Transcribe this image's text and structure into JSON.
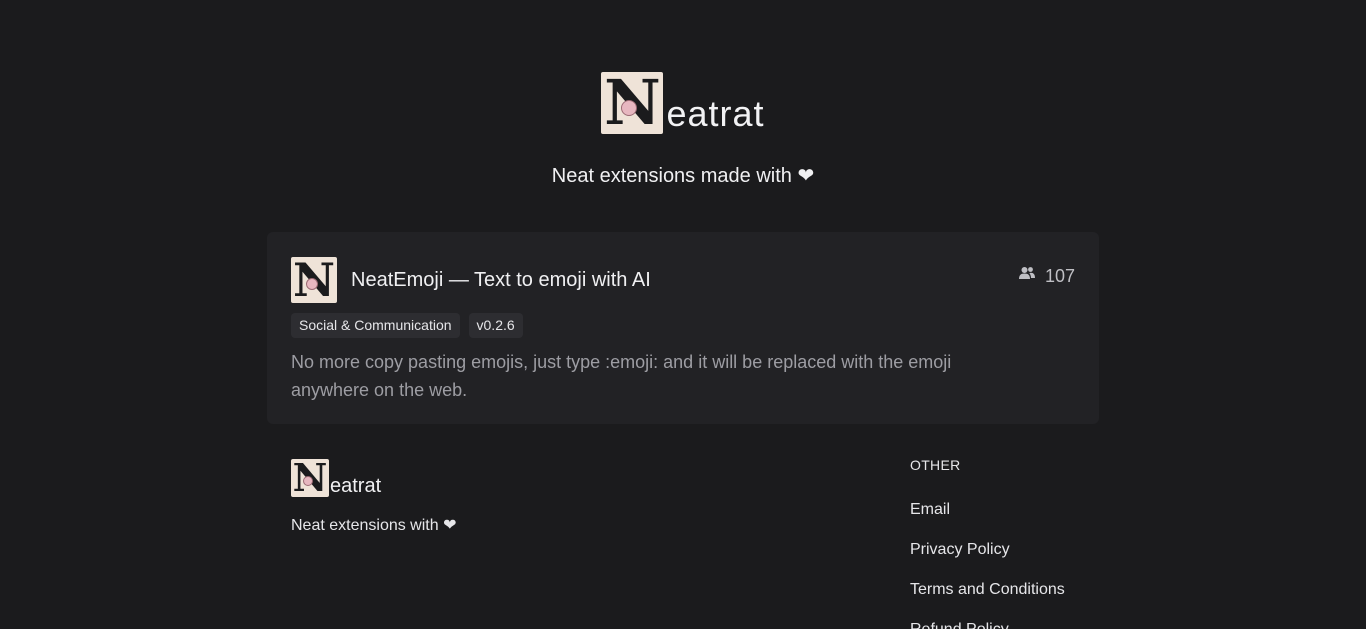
{
  "hero": {
    "brand_suffix": "eatrat",
    "subtitle": "Neat extensions made with ❤"
  },
  "extensions": [
    {
      "title": "NeatEmoji — Text to emoji with AI",
      "users": "107",
      "users_icon": "users-icon",
      "tags": [
        "Social & Communication",
        "v0.2.6"
      ],
      "description": "No more copy pasting emojis, just type :emoji: and it will be replaced with the emoji anywhere on the web."
    }
  ],
  "footer": {
    "brand_suffix": "eatrat",
    "tagline": "Neat extensions with ❤",
    "other": {
      "heading": "OTHER",
      "links": [
        "Email",
        "Privacy Policy",
        "Terms and Conditions",
        "Refund Policy"
      ]
    }
  },
  "logo": {
    "letter": "N",
    "background": "#efe3d8",
    "accent": "#e7b7c0"
  },
  "colors": {
    "background": "#1b1b1d",
    "card": "#222225",
    "tag": "#2d2d31",
    "muted_text": "#9d9da3"
  }
}
